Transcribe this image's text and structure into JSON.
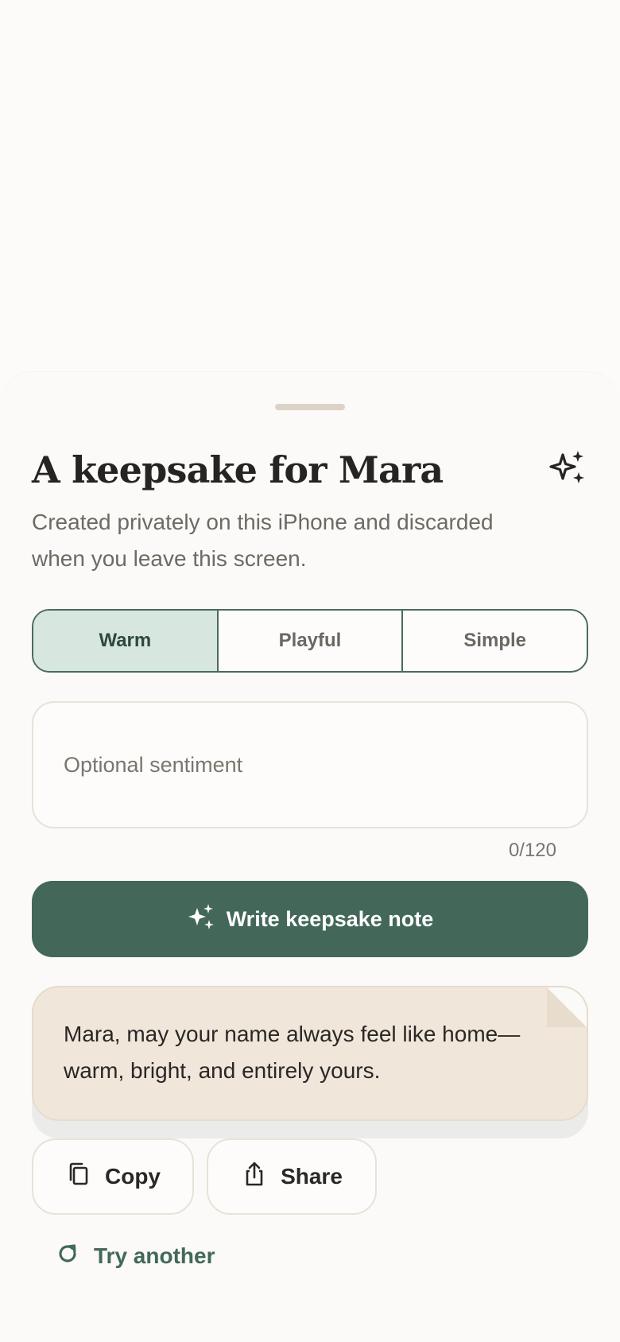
{
  "sheet": {
    "title": "A keepsake for Mara",
    "subtitle": "Created privately on this iPhone and discarded when you leave this screen."
  },
  "tone": {
    "options": [
      "Warm",
      "Playful",
      "Simple"
    ],
    "selected": "Warm"
  },
  "sentiment": {
    "placeholder": "Optional sentiment",
    "value": "",
    "counter": "0/120"
  },
  "write_button": {
    "label": "Write keepsake note"
  },
  "note": {
    "text": "Mara, may your name always feel like home—warm, bright, and entirely yours."
  },
  "actions": {
    "copy_label": "Copy",
    "share_label": "Share",
    "try_another_label": "Try another"
  },
  "icons": {
    "header": "sparkles-icon",
    "write": "sparkles-icon",
    "copy": "copy-icon",
    "share": "share-icon",
    "try_another": "refresh-icon"
  },
  "colors": {
    "accent": "#43685a",
    "segment_active_bg": "#d8e6e0",
    "note_bg": "#f1e6da",
    "background": "#fbfaf8"
  }
}
